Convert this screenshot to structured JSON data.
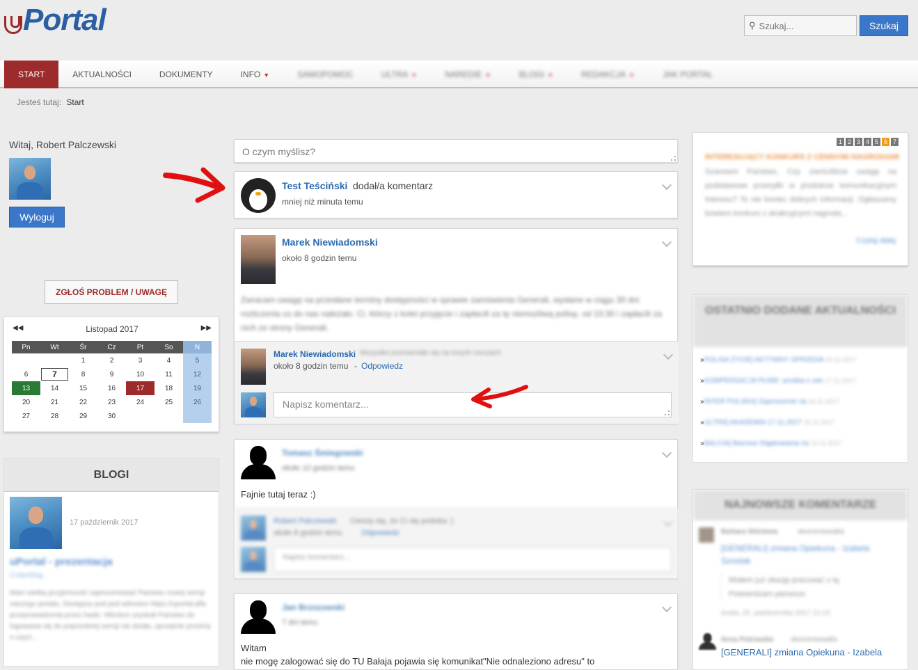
{
  "header": {
    "logo": "Portal",
    "search_placeholder": "Szukaj...",
    "search_button": "Szukaj"
  },
  "nav": {
    "items": [
      {
        "label": "START",
        "active": true,
        "caret": false,
        "blurred": false
      },
      {
        "label": "AKTUALNOŚCI",
        "active": false,
        "caret": false,
        "blurred": false
      },
      {
        "label": "DOKUMENTY",
        "active": false,
        "caret": false,
        "blurred": false
      },
      {
        "label": "INFO",
        "active": false,
        "caret": true,
        "blurred": false
      },
      {
        "label": "SAMOPOMOC",
        "active": false,
        "caret": false,
        "blurred": true
      },
      {
        "label": "ULTRA",
        "active": false,
        "caret": true,
        "blurred": true
      },
      {
        "label": "NAREDIE",
        "active": false,
        "caret": true,
        "blurred": true
      },
      {
        "label": "BLOGI",
        "active": false,
        "caret": true,
        "blurred": true
      },
      {
        "label": "REDAKCJA",
        "active": false,
        "caret": true,
        "blurred": true
      },
      {
        "label": "jak portal",
        "active": false,
        "caret": false,
        "blurred": true
      }
    ]
  },
  "breadcrumb": {
    "label": "Jesteś tutaj:",
    "current": "Start"
  },
  "left": {
    "welcome": "Witaj, Robert Palczewski",
    "logout": "Wyloguj",
    "report": "ZGŁOŚ PROBLEM / UWAGĘ",
    "calendar": {
      "title": "Listopad 2017",
      "prev": "◀◀",
      "next": "▶▶",
      "weekdays": [
        "Pn",
        "Wt",
        "Śr",
        "Cz",
        "Pt",
        "So",
        "N"
      ],
      "weeks": [
        [
          "",
          "",
          "1",
          "2",
          "3",
          "4",
          "5"
        ],
        [
          "6",
          "7",
          "8",
          "9",
          "10",
          "11",
          "12"
        ],
        [
          "13",
          "14",
          "15",
          "16",
          "17",
          "18",
          "19"
        ],
        [
          "20",
          "21",
          "22",
          "23",
          "24",
          "25",
          "26"
        ],
        [
          "27",
          "28",
          "29",
          "30",
          "",
          "",
          ""
        ]
      ],
      "today": "7",
      "green": "13",
      "red": "17"
    },
    "blogs": {
      "title": "BLOGI",
      "date": "17 październik 2017",
      "post_title": "uPortal - prezentacja",
      "category": "Coterblog",
      "text": "Mam wielką przyjemność zaprezentować Państwu nowej wersji naszego portalu. Dostępny pod pod adresem https://uportal.alfa przeprowadzenia przez hasło. Wkrótce uzyskali Państwo do logowania się do poprzedniej wersji nie działa, uprzejmie prosimy o uzyci..."
    }
  },
  "feed": {
    "status_placeholder": "O czym myślisz?",
    "posts": [
      {
        "author": "Test Teściński",
        "action": "dodał/a komentarz",
        "time": "mniej niż minuta temu"
      },
      {
        "author": "Marek Niewiadomski",
        "time": "około 8 godzin temu",
        "text": "Zwracam uwagę na przesłane terminy dostępności w sprawie zamówienia Generali, wysłane w ciągu 30 dni rozliczenia co do nas należało. Ci, którzy z kolei przyjęcie i zapłacili za tę niemożliwą polisę, od 10:30 i zapłacili za nich ze strony Generali.",
        "comment": {
          "author": "Marek Niewiadomski",
          "text": "Wszystko pozmieniało się na innych rzeczach",
          "time": "około 8 godzin temu",
          "reply": "Odpowiedz"
        },
        "reply_placeholder": "Napisz komentarz..."
      },
      {
        "author": "Tomasz Śmiegowski",
        "time": "około 10 godzin temu",
        "text": "Fajnie tutaj teraz :)",
        "comment": {
          "author": "Robert Palczewski",
          "text": "Cieszę się, że Ci się podoba :)",
          "time": "około 8 godzin temu",
          "reply": "Odpowiedz"
        },
        "reply_placeholder": "Napisz komentarz..."
      },
      {
        "author": "Jan Brzozowski",
        "time": "7 dni temu",
        "text": "Witam",
        "text2": "nie mogę zalogować się do TU Bałaja pojawia się komunikat\"Nie odnaleziono adresu\" to"
      }
    ]
  },
  "right": {
    "pager": [
      "1",
      "2",
      "3",
      "4",
      "5",
      "6",
      "7"
    ],
    "pager_active": "6",
    "promo_title": "INTERESUJĄCY KONKURS Z CENNYMI NAGRODAMI",
    "promo_text": "Szanowni Państwo, Czy zwróciliście uwagę na podstawowe przesyłki w produkcie komunikacyjnym Interesu? To nie koniec dobrych informacji. Ogłaszamy bowiem konkurs z atrakcyjnymi nagroda...",
    "promo_more": "Czytaj dalej",
    "news_title": "OSTATNIO DODANE AKTUALNOŚCI",
    "news": [
      {
        "t": "POLISA ŻYCIE] AKTYWNY SPRZEDA",
        "d": "20.11.2017"
      },
      {
        "t": "KOMPENSACJA PŁMIE: prośba o zan",
        "d": "17.11.2017"
      },
      {
        "t": "INTER POLSKA] Zaproszenie na",
        "d": "16.11.2017"
      },
      {
        "t": "ULTRA] AKADEMIA 17.11.2017",
        "d": "15.11.2017"
      },
      {
        "t": "BALCIA] Bazowa Stąpkowania na",
        "d": "10.11.2017"
      }
    ],
    "comments_title": "NAJNOWSZE KOMENTARZE",
    "comments": [
      {
        "author": "Barbara Wiśniewa",
        "action": "skomentował/a",
        "link": "[GENERALI] zmiana Opiekuna - Izabela Szostak",
        "quote": "Miałem już okazję pracować z tą Potwierdzam pierwsze",
        "date": "środa, 25. października 2017 12:13"
      },
      {
        "author": "Anna Piotrowska",
        "action": "skomentował/a",
        "link": "[GENERALI] zmiana Opiekuna - Izabela"
      }
    ]
  }
}
